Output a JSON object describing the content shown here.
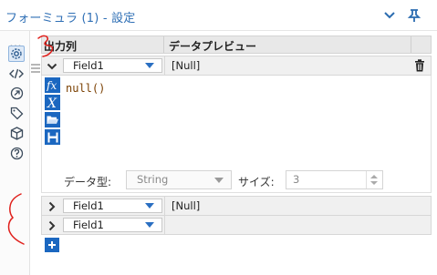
{
  "window": {
    "title": "フォーミュラ (1) - 設定",
    "icons": [
      "chevron-down-icon",
      "pin-icon"
    ]
  },
  "rail": {
    "items": [
      "gear-icon",
      "code-icon",
      "navigate-icon",
      "tag-icon",
      "cube-icon",
      "help-icon"
    ]
  },
  "table": {
    "headers": {
      "output": "出力列",
      "preview": "データプレビュー"
    },
    "rows": [
      {
        "field": "Field1",
        "preview": "[Null]",
        "expanded": true
      },
      {
        "field": "Field1",
        "preview": "[Null]",
        "expanded": false
      },
      {
        "field": "Field1",
        "preview": "",
        "expanded": false
      }
    ]
  },
  "editor": {
    "expression": "null()",
    "tools": [
      "fx-icon",
      "variable-icon",
      "open-folder-icon",
      "save-icon"
    ],
    "data_type_label": "データ型:",
    "data_type_value": "String",
    "size_label": "サイズ:",
    "size_value": "3"
  },
  "colors": {
    "accent": "#1b67c0",
    "title": "#2f6fb5",
    "annotation": "#e0201c"
  }
}
